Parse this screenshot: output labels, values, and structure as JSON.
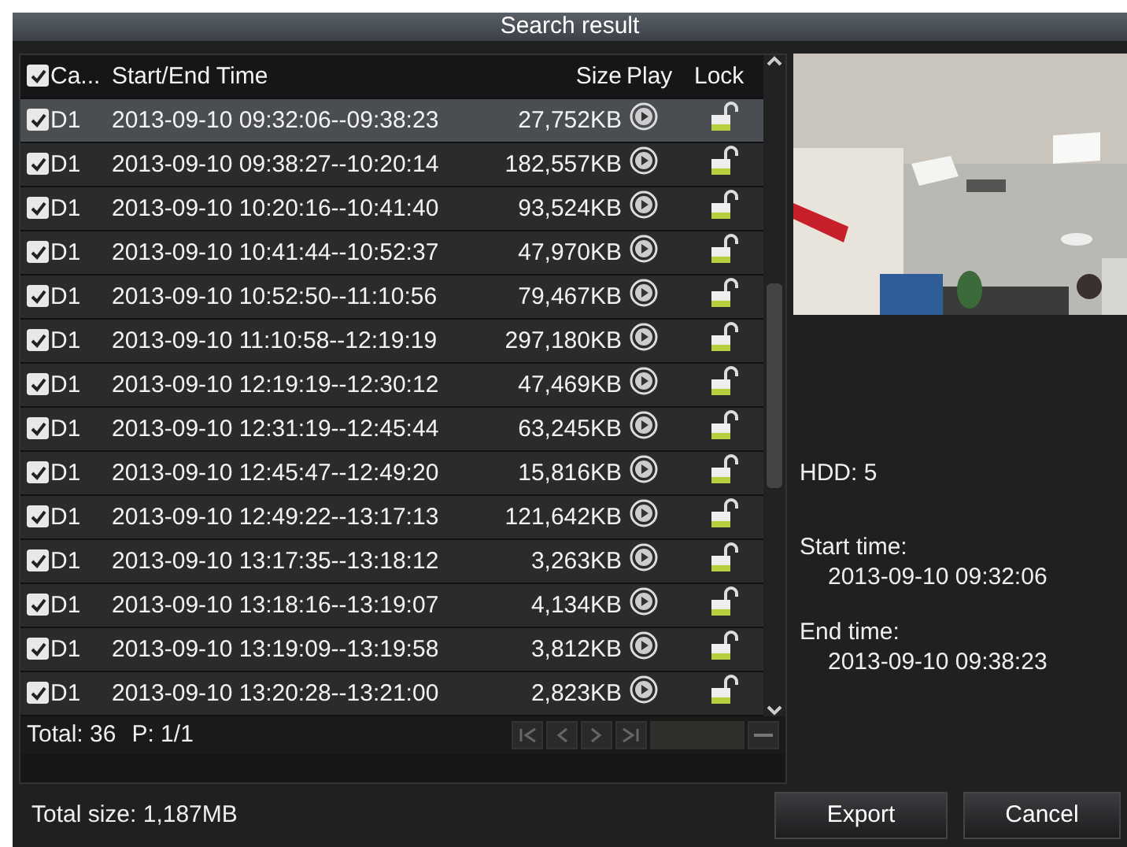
{
  "window": {
    "title": "Search result"
  },
  "table": {
    "header_checked": true,
    "columns": [
      "Ca...",
      "Start/End Time",
      "Size",
      "Play",
      "Lock"
    ],
    "rows": [
      {
        "checked": true,
        "camera": "D1",
        "time": "2013-09-10 09:32:06--09:38:23",
        "size": "27,752KB",
        "locked": false,
        "selected": true
      },
      {
        "checked": true,
        "camera": "D1",
        "time": "2013-09-10 09:38:27--10:20:14",
        "size": "182,557KB",
        "locked": false,
        "selected": false
      },
      {
        "checked": true,
        "camera": "D1",
        "time": "2013-09-10 10:20:16--10:41:40",
        "size": "93,524KB",
        "locked": false,
        "selected": false
      },
      {
        "checked": true,
        "camera": "D1",
        "time": "2013-09-10 10:41:44--10:52:37",
        "size": "47,970KB",
        "locked": false,
        "selected": false
      },
      {
        "checked": true,
        "camera": "D1",
        "time": "2013-09-10 10:52:50--11:10:56",
        "size": "79,467KB",
        "locked": false,
        "selected": false
      },
      {
        "checked": true,
        "camera": "D1",
        "time": "2013-09-10 11:10:58--12:19:19",
        "size": "297,180KB",
        "locked": false,
        "selected": false
      },
      {
        "checked": true,
        "camera": "D1",
        "time": "2013-09-10 12:19:19--12:30:12",
        "size": "47,469KB",
        "locked": false,
        "selected": false
      },
      {
        "checked": true,
        "camera": "D1",
        "time": "2013-09-10 12:31:19--12:45:44",
        "size": "63,245KB",
        "locked": false,
        "selected": false
      },
      {
        "checked": true,
        "camera": "D1",
        "time": "2013-09-10 12:45:47--12:49:20",
        "size": "15,816KB",
        "locked": false,
        "selected": false
      },
      {
        "checked": true,
        "camera": "D1",
        "time": "2013-09-10 12:49:22--13:17:13",
        "size": "121,642KB",
        "locked": false,
        "selected": false
      },
      {
        "checked": true,
        "camera": "D1",
        "time": "2013-09-10 13:17:35--13:18:12",
        "size": "3,263KB",
        "locked": false,
        "selected": false
      },
      {
        "checked": true,
        "camera": "D1",
        "time": "2013-09-10 13:18:16--13:19:07",
        "size": "4,134KB",
        "locked": false,
        "selected": false
      },
      {
        "checked": true,
        "camera": "D1",
        "time": "2013-09-10 13:19:09--13:19:58",
        "size": "3,812KB",
        "locked": false,
        "selected": false
      },
      {
        "checked": true,
        "camera": "D1",
        "time": "2013-09-10 13:20:28--13:21:00",
        "size": "2,823KB",
        "locked": false,
        "selected": false
      }
    ]
  },
  "footer": {
    "total": "Total: 36",
    "page": "P: 1/1"
  },
  "info": {
    "hdd": "HDD: 5",
    "start_label": "Start time:",
    "start_value": "2013-09-10 09:32:06",
    "end_label": "End time:",
    "end_value": "2013-09-10 09:38:23"
  },
  "total_size": "Total size: 1,187MB",
  "buttons": [
    "Export",
    "Cancel"
  ]
}
